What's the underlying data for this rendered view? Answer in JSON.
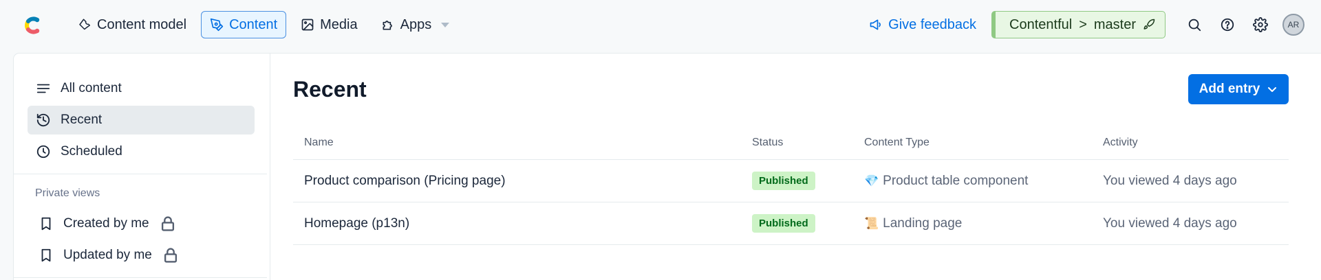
{
  "nav": {
    "items": [
      {
        "label": "Content model",
        "icon": "wrench-icon"
      },
      {
        "label": "Content",
        "icon": "pen-icon",
        "active": true
      },
      {
        "label": "Media",
        "icon": "image-icon"
      },
      {
        "label": "Apps",
        "icon": "puzzle-icon"
      }
    ]
  },
  "header": {
    "feedback_label": "Give feedback",
    "env_space": "Contentful",
    "env_separator": ">",
    "env_name": "master",
    "avatar_initials": "AR"
  },
  "sidebar": {
    "items": [
      {
        "label": "All content",
        "icon": "list-icon"
      },
      {
        "label": "Recent",
        "icon": "history-icon",
        "active": true
      },
      {
        "label": "Scheduled",
        "icon": "clock-icon"
      }
    ],
    "private_heading": "Private views",
    "private_items": [
      {
        "label": "Created by me",
        "icon": "bookmark-icon"
      },
      {
        "label": "Updated by me",
        "icon": "bookmark-icon"
      }
    ]
  },
  "main": {
    "title": "Recent",
    "add_button_label": "Add entry",
    "columns": [
      "Name",
      "Status",
      "Content Type",
      "Activity"
    ],
    "rows": [
      {
        "name": "Product comparison (Pricing page)",
        "status": "Published",
        "type_icon": "💎",
        "type": "Product table component",
        "activity": "You viewed 4 days ago"
      },
      {
        "name": "Homepage (p13n)",
        "status": "Published",
        "type_icon": "📜",
        "type": "Landing page",
        "activity": "You viewed 4 days ago"
      }
    ]
  },
  "colors": {
    "accent": "#036fe3",
    "published_bg": "#cdf3c6",
    "published_text": "#006a1a",
    "env_bg": "#e8f7e4"
  }
}
